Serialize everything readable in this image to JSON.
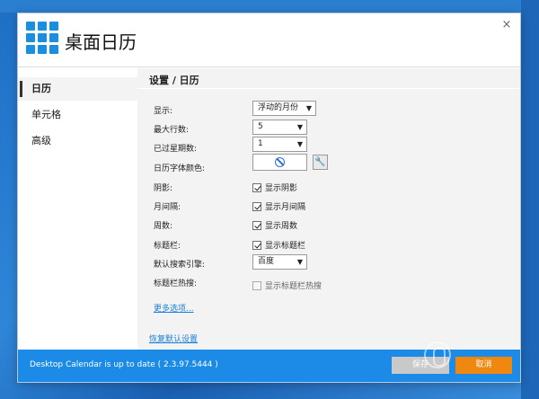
{
  "window": {
    "title": "桌面日历",
    "close_glyph": "×"
  },
  "sidebar": {
    "items": [
      {
        "label": "日历",
        "active": true
      },
      {
        "label": "单元格",
        "active": false
      },
      {
        "label": "高级",
        "active": false
      }
    ]
  },
  "content": {
    "breadcrumb": "设置 / 日历",
    "labels": {
      "display": "显示:",
      "max_rows": "最大行数:",
      "past_weeks": "已过星期数:",
      "font_color": "日历字体颜色:",
      "shadow": "阴影:",
      "month_gap": "月间隔:",
      "week_num": "周数:",
      "titlebar": "标题栏:",
      "search_engine": "默认搜索引擎:",
      "titlebar_hot": "标题栏热搜:"
    },
    "display_select": "浮动的月份",
    "max_rows_select": "5",
    "past_weeks_select": "1",
    "search_engine_select": "百度",
    "checkboxes": {
      "shadow": {
        "label": "显示阴影",
        "checked": true
      },
      "month_gap": {
        "label": "显示月间隔",
        "checked": true
      },
      "week_num": {
        "label": "显示周数",
        "checked": true
      },
      "titlebar": {
        "label": "显示标题栏",
        "checked": true
      },
      "titlebar_hot": {
        "label": "显示标题栏热搜",
        "checked": false
      }
    },
    "more_options": "更多选项...",
    "restore_defaults": "恢复默认设置"
  },
  "footer": {
    "status": "Desktop Calendar is up to date ( 2.3.97.5444 )",
    "save_label": "保存",
    "cancel_label": "取消"
  },
  "icons": {
    "app": "grid-calendar-icon",
    "color": "no-color-icon",
    "wrench": "wrench-icon",
    "dropdown": "chevron-down-icon"
  },
  "colors": {
    "accent": "#1c8be8",
    "cancel": "#f0880f",
    "save_disabled": "#c9c9c9"
  }
}
